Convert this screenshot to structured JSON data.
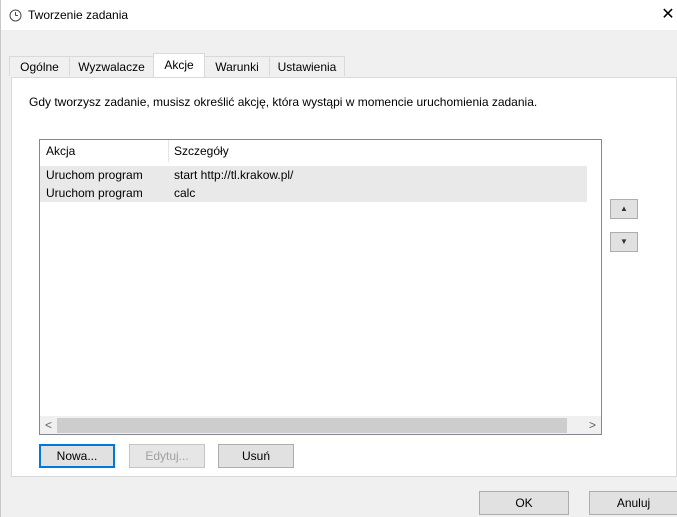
{
  "window": {
    "title": "Tworzenie zadania",
    "close_glyph": "✕",
    "title_icon": "clock-icon"
  },
  "tabs": [
    {
      "label": "Ogólne",
      "active": false
    },
    {
      "label": "Wyzwalacze",
      "active": false
    },
    {
      "label": "Akcje",
      "active": true
    },
    {
      "label": "Warunki",
      "active": false
    },
    {
      "label": "Ustawienia",
      "active": false
    }
  ],
  "actions_tab": {
    "description": "Gdy tworzysz zadanie, musisz określić akcję, która wystąpi w momencie uruchomienia zadania.",
    "columns": [
      "Akcja",
      "Szczegóły"
    ],
    "rows": [
      {
        "action": "Uruchom program",
        "details": "start http://tl.krakow.pl/"
      },
      {
        "action": "Uruchom program",
        "details": "calc"
      }
    ],
    "scroll_left": "<",
    "scroll_right": ">",
    "move_up": "▲",
    "move_down": "▼",
    "buttons": {
      "new": "Nowa...",
      "edit": "Edytuj...",
      "delete": "Usuń"
    }
  },
  "footer": {
    "ok": "OK",
    "cancel": "Anuluj"
  },
  "colors": {
    "accent": "#0078d7",
    "row_selected": "#e9e9e9"
  }
}
